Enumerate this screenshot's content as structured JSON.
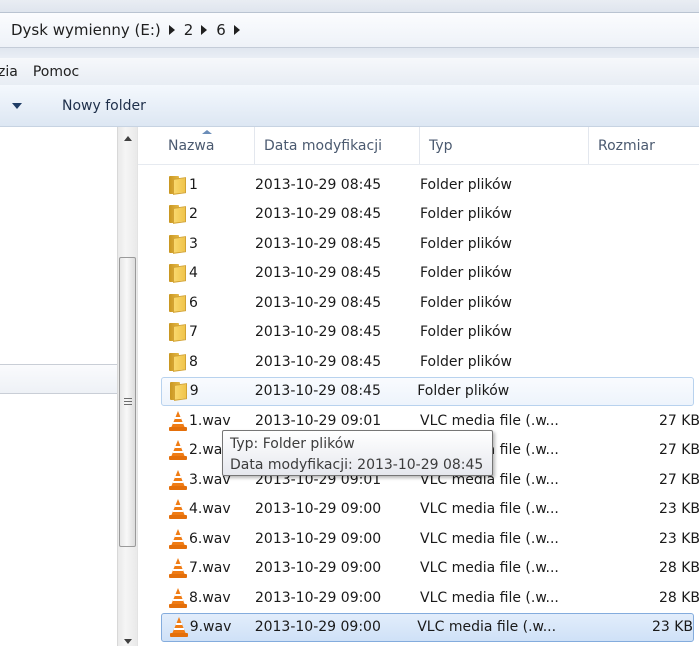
{
  "address": {
    "crumbs": [
      "Dysk wymienny (E:)",
      "2",
      "6"
    ]
  },
  "menu": {
    "items": [
      "zia",
      "Pomoc"
    ]
  },
  "toolbar": {
    "new_folder_label": "Nowy folder"
  },
  "columns": {
    "name": "Nazwa",
    "date": "Data modyfikacji",
    "type": "Typ",
    "size": "Rozmiar"
  },
  "files": [
    {
      "icon": "folder-icon",
      "name": "1",
      "date": "2013-10-29 08:45",
      "type": "Folder plików",
      "size": ""
    },
    {
      "icon": "folder-icon",
      "name": "2",
      "date": "2013-10-29 08:45",
      "type": "Folder plików",
      "size": ""
    },
    {
      "icon": "folder-icon",
      "name": "3",
      "date": "2013-10-29 08:45",
      "type": "Folder plików",
      "size": ""
    },
    {
      "icon": "folder-icon",
      "name": "4",
      "date": "2013-10-29 08:45",
      "type": "Folder plików",
      "size": ""
    },
    {
      "icon": "folder-icon",
      "name": "6",
      "date": "2013-10-29 08:45",
      "type": "Folder plików",
      "size": ""
    },
    {
      "icon": "folder-icon",
      "name": "7",
      "date": "2013-10-29 08:45",
      "type": "Folder plików",
      "size": ""
    },
    {
      "icon": "folder-icon",
      "name": "8",
      "date": "2013-10-29 08:45",
      "type": "Folder plików",
      "size": ""
    },
    {
      "icon": "folder-icon",
      "name": "9",
      "date": "2013-10-29 08:45",
      "type": "Folder plików",
      "size": "",
      "state": "hover"
    },
    {
      "icon": "vlc-cone-icon",
      "name": "1.wav",
      "date": "2013-10-29 09:01",
      "type": "VLC media file (.w...",
      "size": "27 KB"
    },
    {
      "icon": "vlc-cone-icon",
      "name": "2.wav",
      "date": "2013-10-29 09:01",
      "type": "VLC media file (.w...",
      "size": "27 KB"
    },
    {
      "icon": "vlc-cone-icon",
      "name": "3.wav",
      "date": "2013-10-29 09:01",
      "type": "VLC media file (.w...",
      "size": "27 KB"
    },
    {
      "icon": "vlc-cone-icon",
      "name": "4.wav",
      "date": "2013-10-29 09:00",
      "type": "VLC media file (.w...",
      "size": "23 KB"
    },
    {
      "icon": "vlc-cone-icon",
      "name": "6.wav",
      "date": "2013-10-29 09:00",
      "type": "VLC media file (.w...",
      "size": "23 KB"
    },
    {
      "icon": "vlc-cone-icon",
      "name": "7.wav",
      "date": "2013-10-29 09:00",
      "type": "VLC media file (.w...",
      "size": "28 KB"
    },
    {
      "icon": "vlc-cone-icon",
      "name": "8.wav",
      "date": "2013-10-29 09:00",
      "type": "VLC media file (.w...",
      "size": "28 KB"
    },
    {
      "icon": "vlc-cone-icon",
      "name": "9.wav",
      "date": "2013-10-29 09:00",
      "type": "VLC media file (.w...",
      "size": "23 KB",
      "state": "selected"
    }
  ],
  "tooltip": {
    "line1": "Typ: Folder plików",
    "line2": "Data modyfikacji: 2013-10-29 08:45"
  },
  "colors": {
    "selection_border": "#84acdd",
    "hover_border": "#b8d2ee",
    "folder": "#f0c44b",
    "vlc_orange": "#f07c14"
  }
}
